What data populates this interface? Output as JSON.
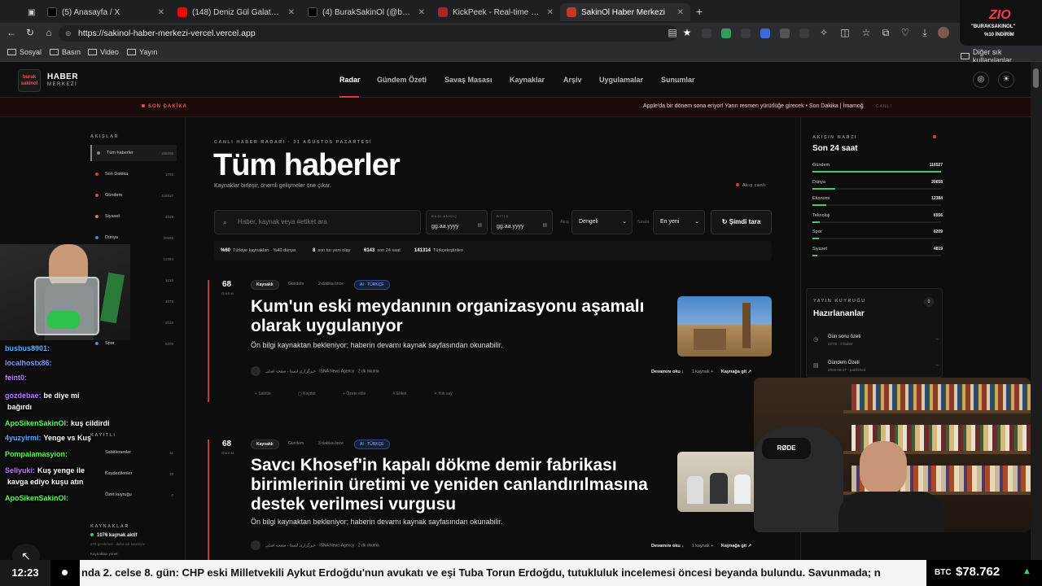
{
  "browser": {
    "tabs": [
      {
        "title": "(5) Anasayfa / X",
        "color": "#000000"
      },
      {
        "title": "(148) Deniz Gül Galatasaray'da?...",
        "color": "#ff0000"
      },
      {
        "title": "(4) BurakSakinOl (@buraktut_) / X",
        "color": "#000000"
      },
      {
        "title": "KickPeek - Real-time URL Crawler",
        "color": "#a8262b"
      },
      {
        "title": "SakinOl Haber Merkezi",
        "color": "#c0392b"
      }
    ],
    "new_tab": "+",
    "url": "https://sakinol-haber-merkezi-vercel.vercel.app",
    "bookmarks": [
      "Sosyal",
      "Basın",
      "Video",
      "Yayın"
    ],
    "other_bookmarks": "Diğer sık kullanılanlar"
  },
  "site": {
    "logo_mark": "burak sakinol",
    "logo_title": "HABER",
    "logo_sub": "MERKEZİ",
    "nav": [
      "Radar",
      "Gündem Özeti",
      "Savaş Masası",
      "Kaynaklar",
      "Arşiv",
      "Uygulamalar",
      "Sunumlar"
    ],
    "breaking_label": "SON DAKİKA",
    "breaking_text": "Apple'da bir dönem sona eriyor! Yarın resmen yürürlüğe girecek • Son Dakika | İmamoğ",
    "breaking_tag": "CANLI"
  },
  "left": {
    "title": "AKIŞLAR",
    "feeds": [
      {
        "name": "Tüm haberler",
        "count": "168296",
        "color": "#888888"
      },
      {
        "name": "Son Dakika",
        "count": "1755",
        "color": "#e03a3a"
      },
      {
        "name": "Gündem",
        "count": "116527",
        "color": "#e0483a"
      },
      {
        "name": "Siyaset",
        "count": "4819",
        "color": "#e07a3a"
      },
      {
        "name": "Dünya",
        "count": "20658",
        "color": "#3a8ae0"
      },
      {
        "name": "Ekonomi",
        "count": "12384",
        "color": "#e0c03a"
      },
      {
        "name": "Çevre",
        "count": "1216",
        "color": "#3ac87a"
      },
      {
        "name": "Kültür",
        "count": "1675",
        "color": "#c03ae0"
      },
      {
        "name": "Eğitim",
        "count": "2016",
        "color": "#3ac8c8"
      },
      {
        "name": "Spor",
        "count": "6209",
        "color": "#3a8ae0"
      }
    ],
    "saved_title": "KAYITLI",
    "saved": [
      {
        "name": "Sabitlenenler",
        "count": "11"
      },
      {
        "name": "Kaydedilenler",
        "count": "18"
      },
      {
        "name": "Özet kuyruğu",
        "count": "0"
      }
    ],
    "sources_title": "KAYNAKLAR",
    "sources_active": "1076 kaynak aktif",
    "sources_sub": "378 gecikmeli · daha sık taranıyor",
    "sources_link": "Kaynakları yönet"
  },
  "main": {
    "kicker": "CANLI HABER RADARI · 31 AĞUSTOS PAZARTESİ",
    "headline": "Tüm haberler",
    "subhead": "Kaynaklar birleşir, önemli gelişmeler öne çıkar.",
    "live": "Akış canlı",
    "search_placeholder": "Haber, kaynak veya #etiket ara",
    "date_from_label": "BAŞLANGIÇ",
    "date_to_label": "BİTİŞ",
    "date_placeholder": "gg.aa.yyyy",
    "calendar_icon": "▤",
    "mode_label": "Akış",
    "mode_value": "Dengeli",
    "sort_label": "Sırala",
    "sort_value": "En yeni",
    "scan_button": "Şimdi tara",
    "stats": [
      {
        "v": "%60",
        "t": "Türkiye kaynakları · %40 dünya"
      },
      {
        "v": "8",
        "t": "son tur yeni olay"
      },
      {
        "v": "6143",
        "t": "son 24 saat"
      },
      {
        "v": "141314",
        "t": "Türkçeleştirilen"
      }
    ],
    "articles": [
      {
        "score": "68",
        "unit": "ÖNEM",
        "source": "Kaynaklı",
        "category": "Gündem",
        "time": "2 dakika önce",
        "ai": "AI · TÜRKÇE",
        "title": "Kum'un eski meydanının organizasyonu aşamalı olarak uygulanıyor",
        "desc": "Ön bilgi kaynaktan bekleniyor; haberin devamı kaynak sayfasından okunabilir.",
        "meta": "خبرگزاری ایسنا - صفحه اصلی · ISNA News Agency · 2 dk okuma",
        "read": "Devamını oku ↓",
        "sources": "1 kaynak +",
        "go": "Kaynağa git ↗",
        "tools": [
          "Sabitle",
          "Kaydet",
          "Özete ekle",
          "Etiket",
          "Yok say"
        ]
      },
      {
        "score": "68",
        "unit": "ÖNEM",
        "source": "Kaynaklı",
        "category": "Gündem",
        "time": "3 dakika önce",
        "ai": "AI · TÜRKÇE",
        "title": "Savcı Khosef'in kapalı dökme demir fabrikası birimlerinin üretimi ve yeniden canlandırılmasına destek verilmesi vurgusu",
        "desc": "Ön bilgi kaynaktan bekleniyor; haberin devamı kaynak sayfasından okunabilir.",
        "meta": "خبرگزاری ایسنا - صفحه اصلی · ISNA News Agency · 2 dk okuma",
        "read": "Devamını oku ↓",
        "sources": "1 kaynak +",
        "go": "Kaynağa git ↗"
      }
    ]
  },
  "right": {
    "pulse_title": "AKIŞIN NABZI",
    "pulse_sub": "Son 24 saat",
    "pulse": [
      {
        "name": "Gündem",
        "count": "116527",
        "frac": 1.0
      },
      {
        "name": "Dünya",
        "count": "20658",
        "frac": 0.18
      },
      {
        "name": "Ekonomi",
        "count": "12384",
        "frac": 0.11
      },
      {
        "name": "Teknoloji",
        "count": "6556",
        "frac": 0.06
      },
      {
        "name": "Spor",
        "count": "6209",
        "frac": 0.05
      },
      {
        "name": "Siyaset",
        "count": "4819",
        "frac": 0.04
      }
    ],
    "queue_title": "YAYIN KUYRUĞU",
    "queue_sub": "Hazırlananlar",
    "queue_count": "0",
    "queue": [
      {
        "t": "Gün sonu özeti",
        "s": "22:00 · 0 haber"
      },
      {
        "t": "Gündem Özeti",
        "s": "2026-08-27 · published"
      }
    ]
  },
  "overlay": {
    "zio_logo": "ZIO",
    "zio_t1": "\"BURAKSAKINOL\"",
    "zio_t2": "%10 İNDİRİM",
    "chat": [
      {
        "u": "busbus8901:",
        "m": "",
        "c": "#5ab0ff"
      },
      {
        "u": "localhostx86:",
        "m": "",
        "c": "#8a9aff"
      },
      {
        "u": "feint0:",
        "m": "",
        "c": "#c07aff"
      },
      {
        "u": "gozdebae:",
        "m": "be diye mi",
        "c": "#c07aff"
      },
      {
        "u": "",
        "m": "bağırdı",
        "c": "#ffffff"
      },
      {
        "u": "ApoSikenSakinOl:",
        "m": "kuş cildirdi",
        "c": "#5aff5a"
      },
      {
        "u": "4yuzyirmi:",
        "m": "Yenge vs Kuş",
        "c": "#5ab0ff"
      },
      {
        "u": "Pompalamasyion:",
        "m": "",
        "c": "#5aff5a"
      },
      {
        "u": "Seliyuki:",
        "m": "Kuş yenge ile",
        "c": "#c07aff"
      },
      {
        "u": "",
        "m": "kavga ediyo kuşu atın",
        "c": "#ffffff"
      },
      {
        "u": "ApoSikenSakinOl:",
        "m": "",
        "c": "#5aff5a"
      }
    ]
  },
  "ticker": {
    "clock": "12:23",
    "text": "nda 2. celse 8. gün: CHP eski Milletvekili Aykut Erdoğdu'nun avukatı ve eşi Tuba Torun Erdoğdu, tutukluluk incelemesi öncesi beyanda bulundu. Savunmada; n",
    "btc_label": "BTC",
    "btc_value": "$78.762",
    "btc_trend": "▲"
  }
}
